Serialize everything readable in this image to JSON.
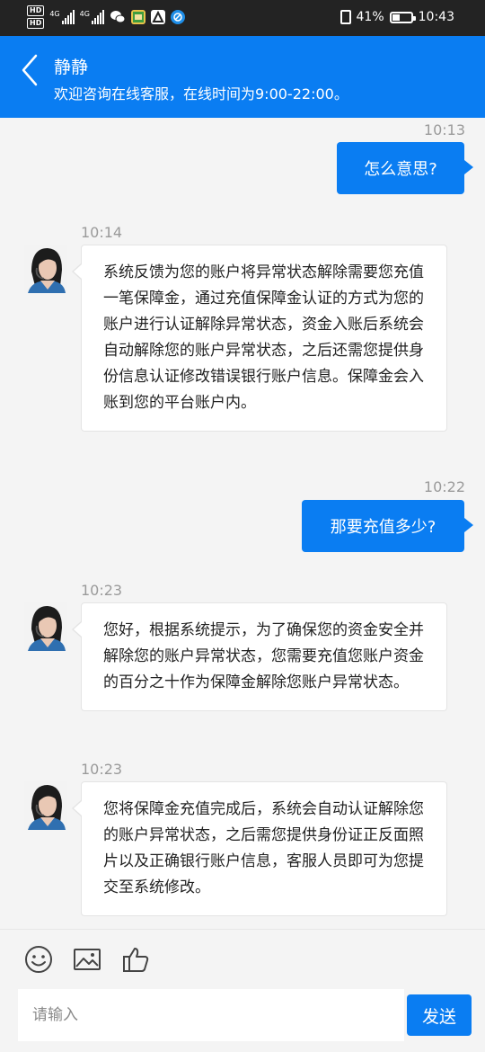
{
  "status_bar": {
    "hd1": "HD",
    "hd2": "HD",
    "net1": "4G",
    "net2": "4G",
    "battery_percent_text": "41%",
    "battery_level": 0.41,
    "time": "10:43"
  },
  "header": {
    "title": "静静",
    "subtitle": "欢迎咨询在线客服，在线时间为9:00-22:00。"
  },
  "messages": [
    {
      "time": "10:13",
      "side": "right",
      "text": "怎么意思?"
    },
    {
      "time": "10:14",
      "side": "left",
      "text": "系统反馈为您的账户将异常状态解除需要您充值一笔保障金，通过充值保障金认证的方式为您的账户进行认证解除异常状态，资金入账后系统会自动解除您的账户异常状态，之后还需您提供身份信息认证修改错误银行账户信息。保障金会入账到您的平台账户内。"
    },
    {
      "time": "10:22",
      "side": "right",
      "text": "那要充值多少?"
    },
    {
      "time": "10:23",
      "side": "left",
      "text": "您好，根据系统提示，为了确保您的资金安全并解除您的账户异常状态，您需要充值您账户资金的百分之十作为保障金解除您账户异常状态。"
    },
    {
      "time": "10:23",
      "side": "left",
      "text": "您将保障金充值完成后，系统会自动认证解除您的账户异常状态，之后需您提供身份证正反面照片以及正确银行账户信息，客服人员即可为您提交至系统修改。"
    }
  ],
  "input": {
    "placeholder": "请输入",
    "value": ""
  },
  "send_label": "发送",
  "colors": {
    "accent": "#0a7df2",
    "status_bar": "#232323",
    "background": "#f4f4f4"
  },
  "icons": [
    "back-arrow-icon",
    "emoji-icon",
    "image-icon",
    "thumbs-up-icon"
  ]
}
